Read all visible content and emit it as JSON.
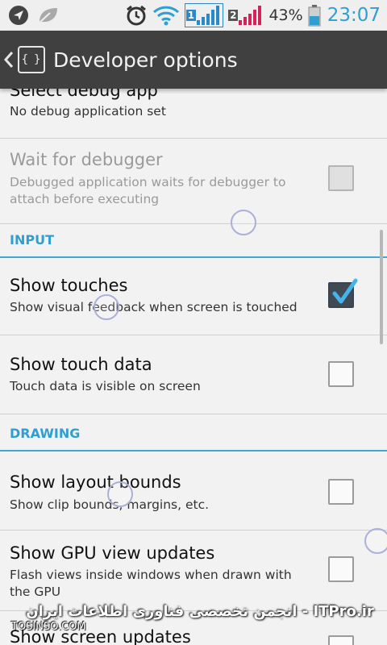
{
  "status_bar": {
    "left_icons": [
      "navigation-arrow-icon",
      "leaf-icon"
    ],
    "right_icons": [
      "alarm-clock-icon",
      "wifi-icon",
      "signal-sim1-icon",
      "signal-sim2-icon",
      "battery-icon"
    ],
    "sim1_label": "1",
    "sim2_label": "2",
    "battery_percent": "43%",
    "time": "23:07",
    "colors": {
      "clock": "#2f9fd1",
      "sim1_signal": "#2a89c7",
      "sim2_signal": "#d0245a"
    }
  },
  "action_bar": {
    "title": "Developer options",
    "icon_glyph": "{ }",
    "icons": [
      "back-chevron-icon",
      "developer-braces-icon"
    ]
  },
  "preferences": [
    {
      "title": "Select debug app",
      "summary": "No debug application set",
      "enabled": true,
      "has_checkbox": false
    },
    {
      "title": "Wait for debugger",
      "summary": "Debugged application waits for debugger to attach before executing",
      "enabled": false,
      "has_checkbox": true,
      "checked": false
    }
  ],
  "section_input": {
    "label": "INPUT",
    "items": [
      {
        "title": "Show touches",
        "summary": "Show visual feedback when screen is touched",
        "checked": true
      },
      {
        "title": "Show touch data",
        "summary": "Touch data is visible on screen",
        "checked": false
      }
    ]
  },
  "section_drawing": {
    "label": "DRAWING",
    "items": [
      {
        "title": "Show layout bounds",
        "summary": "Show clip bounds, margins, etc.",
        "checked": false
      },
      {
        "title": "Show GPU view updates",
        "summary": "Flash views inside windows when drawn with the GPU",
        "checked": false
      },
      {
        "title": "Show screen updates",
        "summary": "",
        "checked": false
      }
    ]
  },
  "watermark": {
    "arabic": "ITPro.ir - انجمن تخصصی فناوری اطلاعات ایران",
    "site": "TOSINSO.COM"
  },
  "accent_color": "#2f9fd1"
}
